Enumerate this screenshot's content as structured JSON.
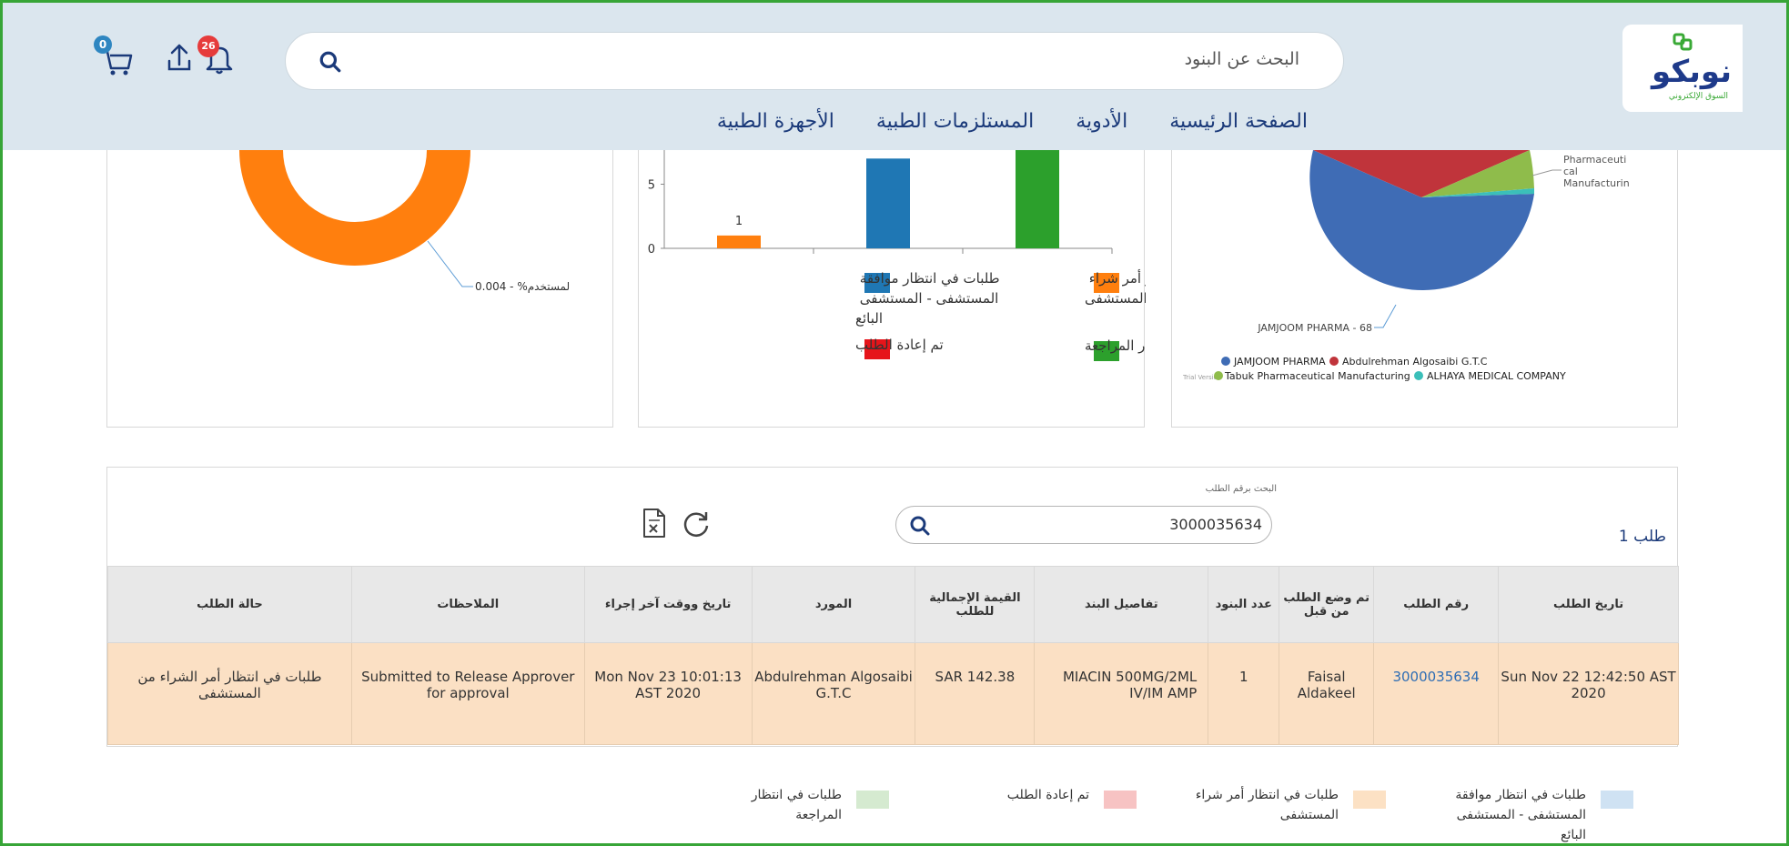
{
  "header": {
    "logo_text": "نوبكو",
    "logo_sub": "السوق الإلكتروني",
    "search_placeholder": "البحث عن البنود",
    "cart_count": "0",
    "notifications_count": "26",
    "nav": [
      "الصفحة الرئيسية",
      "الأدوية",
      "المستلزمات الطبية",
      "الأجهزة الطبية"
    ]
  },
  "colors": {
    "orange": "#ff7f0e",
    "blue": "#1f77b4",
    "green": "#2ca02c",
    "red": "#e6141a",
    "pie_blue": "#3f6cb5",
    "pie_red": "#c0343b",
    "pie_green": "#8fbc4b",
    "pie_teal": "#3bbfb9"
  },
  "charts": {
    "donut_label": "0.004 - %لمستخدم",
    "bar_legend": [
      {
        "label": "طلبات في انتظار أمر شراء المستشفى",
        "color": "#ff7f0e"
      },
      {
        "label": "طلبات في انتظار موافقة المستشفى - المستشفى البائع",
        "color": "#1f77b4"
      },
      {
        "label": "طلبات في انتظار المراجعة",
        "color": "#2ca02c"
      },
      {
        "label": "تم إعادة الطلب",
        "color": "#e6141a"
      }
    ],
    "pie_labels": {
      "jamjoom": "JAMJOOM PHARMA - 68",
      "tabuk_callout": [
        "Pharmaceuti",
        "cal",
        "Manufacturin"
      ],
      "legend": [
        "JAMJOOM PHARMA",
        "Abdulrehman Algosaibi G.T.C",
        "Tabuk Pharmaceutical Manufacturing",
        "ALHAYA MEDICAL COMPANY"
      ],
      "trial": "Trial Version"
    }
  },
  "chart_data": {
    "type": "bar",
    "categories": [
      "طلبات في انتظار أمر شراء المستشفى",
      "طلبات في انتظار موافقة المستشفى - المستشفى البائع",
      "طلبات في انتظار المراجعة"
    ],
    "values": [
      1,
      7,
      8
    ],
    "data_labels": [
      "1",
      "",
      ""
    ],
    "yticks": [
      "0",
      "5"
    ],
    "ylim": [
      0,
      8
    ]
  },
  "orders": {
    "search_label": "البحث برقم الطلب",
    "search_value": "3000035634",
    "count_label": "طلب 1",
    "columns": [
      "تاريخ الطلب",
      "رقم الطلب",
      "تم وضع الطلب من قبل",
      "عدد البنود",
      "تفاصيل البند",
      "القيمة الإجمالية للطلب",
      "المورد",
      "تاريخ ووقت آخر إجراء",
      "الملاحظات",
      "حالة الطلب"
    ],
    "row": {
      "date": "Sun Nov 22 12:42:50 AST 2020",
      "number": "3000035634",
      "by": "Faisal Aldakeel",
      "items": "1",
      "details": "MIACIN 500MG/2ML IV/IM AMP",
      "total": "SAR 142.38",
      "supplier": "Abdulrehman Algosaibi G.T.C",
      "last_action": "Mon Nov 23 10:01:13 AST 2020",
      "notes": "Submitted to Release Approver for approval",
      "status": "طلبات في انتظار أمر الشراء من المستشفى"
    }
  },
  "bottom_legend": [
    {
      "label": "طلبات في انتظار موافقة المستشفى - المستشفى البائع",
      "color": "#cfe2f3"
    },
    {
      "label": "طلبات في انتظار أمر شراء المستشفى",
      "color": "#fce1c4"
    },
    {
      "label": "تم إعادة الطلب",
      "color": "#f7c3c3"
    },
    {
      "label": "طلبات في انتظار المراجعة",
      "color": "#d5ead0"
    }
  ]
}
